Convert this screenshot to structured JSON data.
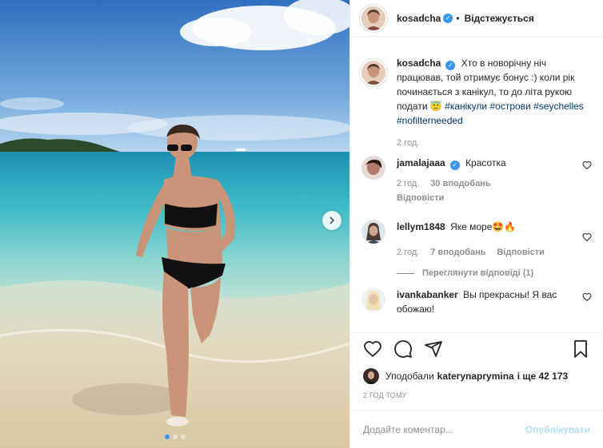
{
  "header": {
    "username": "kosadcha",
    "separator": "•",
    "follow_status": "Відстежується"
  },
  "caption": {
    "username": "kosadcha",
    "text": "Хто в новорічну ніч працював, той отримує бонус :) коли рік починається з канікул, то до літа рукою подати 😇 ",
    "hashtags": [
      "#канікули",
      "#острови",
      "#seychelles",
      "#nofilterneeded"
    ],
    "time": "2 год."
  },
  "comments": [
    {
      "username": "jamalajaaa",
      "verified": true,
      "text": "Красотка",
      "time": "2 год.",
      "likes": "30 вподобань",
      "reply": "Відповісти"
    },
    {
      "username": "lellym1848",
      "verified": false,
      "text": "Яке море🤩🔥",
      "time": "2 год.",
      "likes": "7 вподобань",
      "reply": "Відповісти",
      "view_replies": "Переглянути відповіді (1)"
    },
    {
      "username": "ivankabanker",
      "verified": false,
      "text": "Вы прекрасны! Я вас обожаю!"
    }
  ],
  "likes": {
    "prefix": "Уподобали",
    "user": "katerynaprymina",
    "suffix": "і ще 42 173"
  },
  "time_ago": "2 ГОД ТОМУ",
  "comment_input": {
    "placeholder": "Додайте коментар...",
    "post_label": "Опублікувати"
  },
  "carousel": {
    "current": 1,
    "total": 3
  },
  "colors": {
    "accent": "#3897f0",
    "post_disabled": "#b2dffc",
    "secondary_text": "#8e8e8e"
  },
  "icons": [
    "heart-icon",
    "comment-icon",
    "share-icon",
    "bookmark-icon",
    "verified-icon",
    "chevron-right-icon"
  ]
}
